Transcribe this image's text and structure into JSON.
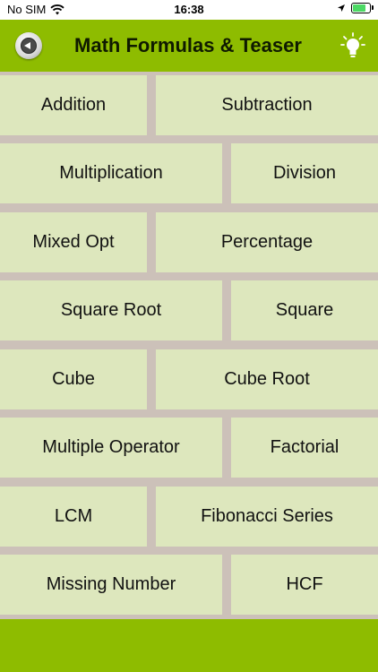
{
  "status": {
    "carrier": "No SIM",
    "time": "16:38"
  },
  "header": {
    "title": "Math Formulas & Teaser",
    "back_icon": "back-arrow-icon",
    "hint_icon": "lightbulb-icon"
  },
  "colors": {
    "header_green": "#8ebc00",
    "cell_bg": "#dde7bd",
    "divider": "#ccc1b9"
  },
  "topics": [
    {
      "label": "Addition"
    },
    {
      "label": "Subtraction"
    },
    {
      "label": "Multiplication"
    },
    {
      "label": "Division"
    },
    {
      "label": "Mixed Opt"
    },
    {
      "label": "Percentage"
    },
    {
      "label": "Square Root"
    },
    {
      "label": "Square"
    },
    {
      "label": "Cube"
    },
    {
      "label": "Cube Root"
    },
    {
      "label": "Multiple Operator"
    },
    {
      "label": "Factorial"
    },
    {
      "label": "LCM"
    },
    {
      "label": "Fibonacci Series"
    },
    {
      "label": "Missing Number"
    },
    {
      "label": "HCF"
    }
  ]
}
